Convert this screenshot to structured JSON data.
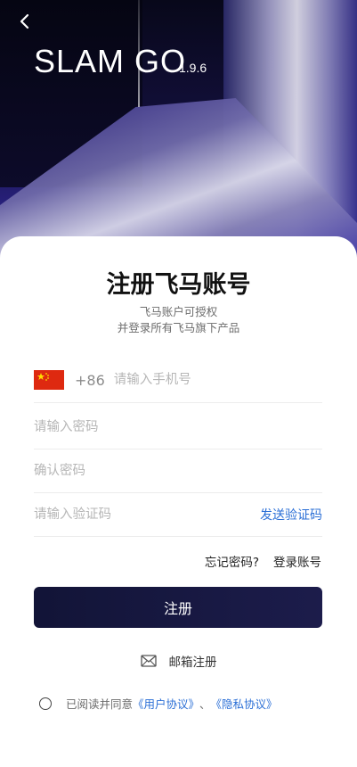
{
  "header": {
    "back_label": "<",
    "app_title": "SLAM GO",
    "version": "1.9.6"
  },
  "sheet": {
    "heading": "注册飞马账号",
    "subtitle_line1": "飞马账户可授权",
    "subtitle_line2": "并登录所有飞马旗下产品"
  },
  "form": {
    "country_code": "+86",
    "phone_placeholder": "请输入手机号",
    "password_placeholder": "请输入密码",
    "confirm_placeholder": "确认密码",
    "code_placeholder": "请输入验证码",
    "send_code_label": "发送验证码"
  },
  "links": {
    "forgot": "忘记密码?",
    "login": "登录账号"
  },
  "actions": {
    "register_label": "注册",
    "email_register_label": "邮箱注册"
  },
  "agreement": {
    "prefix": "已阅读并同意",
    "user_agreement": "《用户协议》",
    "separator": "、",
    "privacy_policy": "《隐私协议》"
  },
  "colors": {
    "primary_button": "#121437",
    "link_blue": "#2b6fd6"
  },
  "icons": {
    "back": "chevron-left-icon",
    "flag": "china-flag-icon",
    "email": "envelope-icon"
  }
}
